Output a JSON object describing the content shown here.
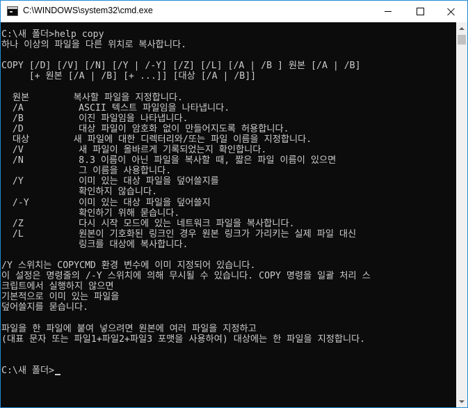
{
  "window": {
    "title": "C:\\WINDOWS\\system32\\cmd.exe",
    "icon": "command-prompt-icon",
    "border_color": "#1f8ad6"
  },
  "controls": {
    "minimize": "minimize-icon",
    "maximize": "maximize-icon",
    "close": "close-icon"
  },
  "console": {
    "background": "#0c0c0c",
    "foreground": "#cccccc",
    "lines": [
      "C:\\새 폴더>help copy",
      "하나 이상의 파일을 다른 위치로 복사합니다.",
      "",
      "COPY [/D] [/V] [/N] [/Y | /-Y] [/Z] [/L] [/A | /B ] 원본 [/A | /B]",
      "     [+ 원본 [/A | /B] [+ ...]] [대상 [/A | /B]]",
      "",
      "  원본        복사할 파일을 지정합니다.",
      "  /A          ASCII 텍스트 파일임을 나타냅니다.",
      "  /B          이진 파일임을 나타냅니다.",
      "  /D          대상 파일이 암호화 없이 만들어지도록 허용합니다.",
      "  대상        새 파일에 대한 디렉터리와/또는 파일 이름을 지정합니다.",
      "  /V          새 파일이 올바르게 기록되었는지 확인합니다.",
      "  /N          8.3 이름이 아닌 파일을 복사할 때, 짧은 파일 이름이 있으면",
      "              그 이름을 사용합니다.",
      "  /Y          이미 있는 대상 파일을 덮어쓸지를",
      "              확인하지 않습니다.",
      "  /-Y         이미 있는 대상 파일을 덮어쓸지",
      "              확인하기 위해 묻습니다.",
      "  /Z          다시 시작 모드에 있는 네트워크 파일을 복사합니다.",
      "  /L          원본이 기호화된 링크인 경우 원본 링크가 가리키는 실제 파일 대신",
      "              링크를 대상에 복사합니다.",
      "",
      "/Y 스위치는 COPYCMD 환경 변수에 이미 지정되어 있습니다.",
      "이 설정은 명령줄의 /-Y 스위치에 의해 무시될 수 있습니다. COPY 명령을 일괄 처리 스",
      "크립트에서 실행하지 않으면",
      "기본적으로 이미 있는 파일을",
      "덮어쓸지를 묻습니다.",
      "",
      "파일을 한 파일에 붙여 넣으려면 원본에 여러 파일을 지정하고",
      "(대표 문자 또는 파일1+파일2+파일3 포맷을 사용하여) 대상에는 한 파일을 지정합니다.",
      "",
      "",
      "C:\\새 폴더>"
    ]
  },
  "scrollbar": {
    "up": "scroll-up-arrow-icon",
    "down": "scroll-down-arrow-icon"
  }
}
